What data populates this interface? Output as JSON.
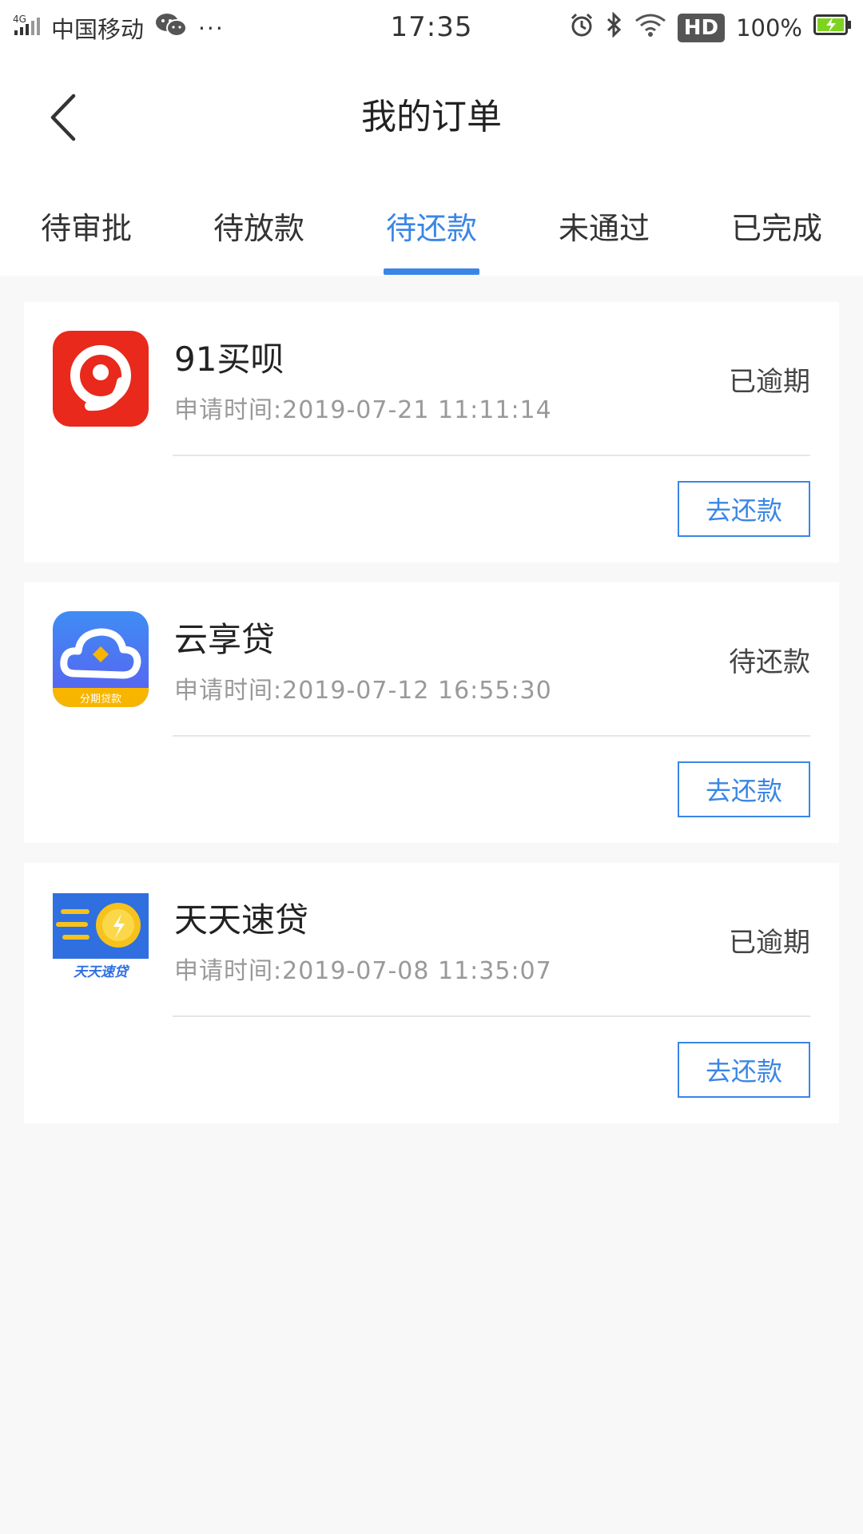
{
  "status_bar": {
    "network": "4G",
    "carrier": "中国移动",
    "more": "···",
    "time": "17:35",
    "hd": "HD",
    "battery": "100%"
  },
  "header": {
    "title": "我的订单"
  },
  "tabs": [
    {
      "label": "待审批"
    },
    {
      "label": "待放款"
    },
    {
      "label": "待还款",
      "active": true
    },
    {
      "label": "未通过"
    },
    {
      "label": "已完成"
    }
  ],
  "orders": [
    {
      "name": "91买呗",
      "time": "申请时间:2019-07-21 11:11:14",
      "status": "已逾期",
      "button": "去还款",
      "icon": "91maibei-logo-icon"
    },
    {
      "name": "云享贷",
      "time": "申请时间:2019-07-12 16:55:30",
      "status": "待还款",
      "button": "去还款",
      "icon": "yunxiangdai-logo-icon",
      "icon_caption": "分期贷款"
    },
    {
      "name": "天天速贷",
      "time": "申请时间:2019-07-08 11:35:07",
      "status": "已逾期",
      "button": "去还款",
      "icon": "tiantiansudai-logo-icon",
      "icon_caption": "天天速贷"
    }
  ],
  "colors": {
    "accent": "#3a86e6",
    "background": "#f8f8f8"
  }
}
